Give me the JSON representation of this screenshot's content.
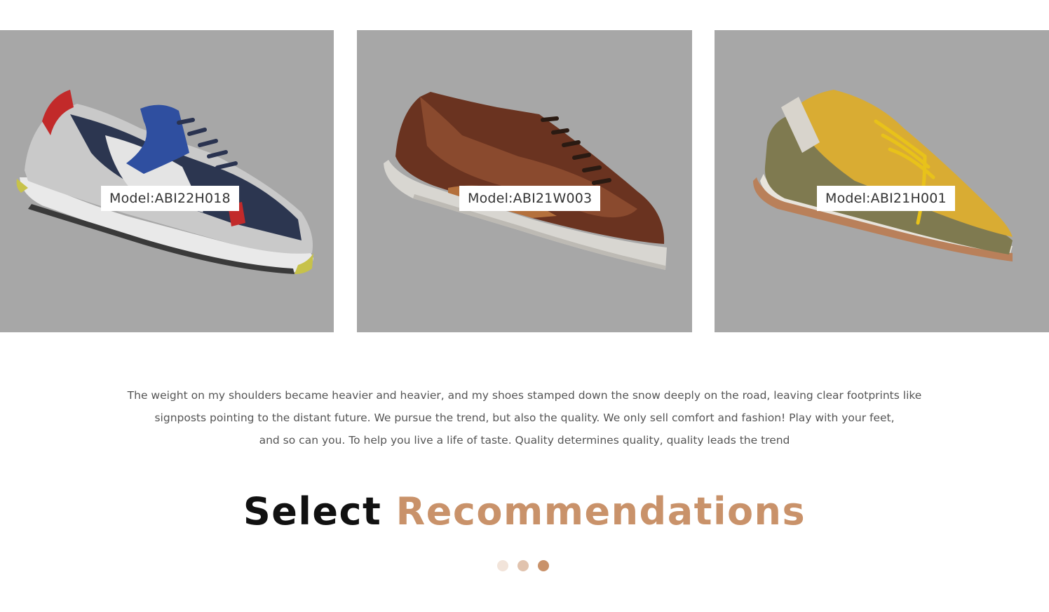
{
  "products": [
    {
      "model_label": "Model:ABI22H018"
    },
    {
      "model_label": "Model:ABI21W003"
    },
    {
      "model_label": "Model:ABI21H001"
    }
  ],
  "description": {
    "line1": "The weight on my shoulders became heavier and heavier, and my shoes stamped down the snow deeply on the road, leaving clear footprints like",
    "line2": "signposts pointing to the distant future. We pursue the trend, but also the quality. We only sell comfort and fashion! Play with your feet,",
    "line3": "and so can you. To help you live a life of taste. Quality determines quality, quality leads the trend"
  },
  "section_heading": {
    "part1": "Select",
    "part2": "Recommendations"
  },
  "pagination": {
    "dot_colors": [
      "#f2e4da",
      "#e1c3ae",
      "#c9926a"
    ]
  },
  "colors": {
    "accent": "#c9926a",
    "card_background": "#a7a7a7"
  }
}
